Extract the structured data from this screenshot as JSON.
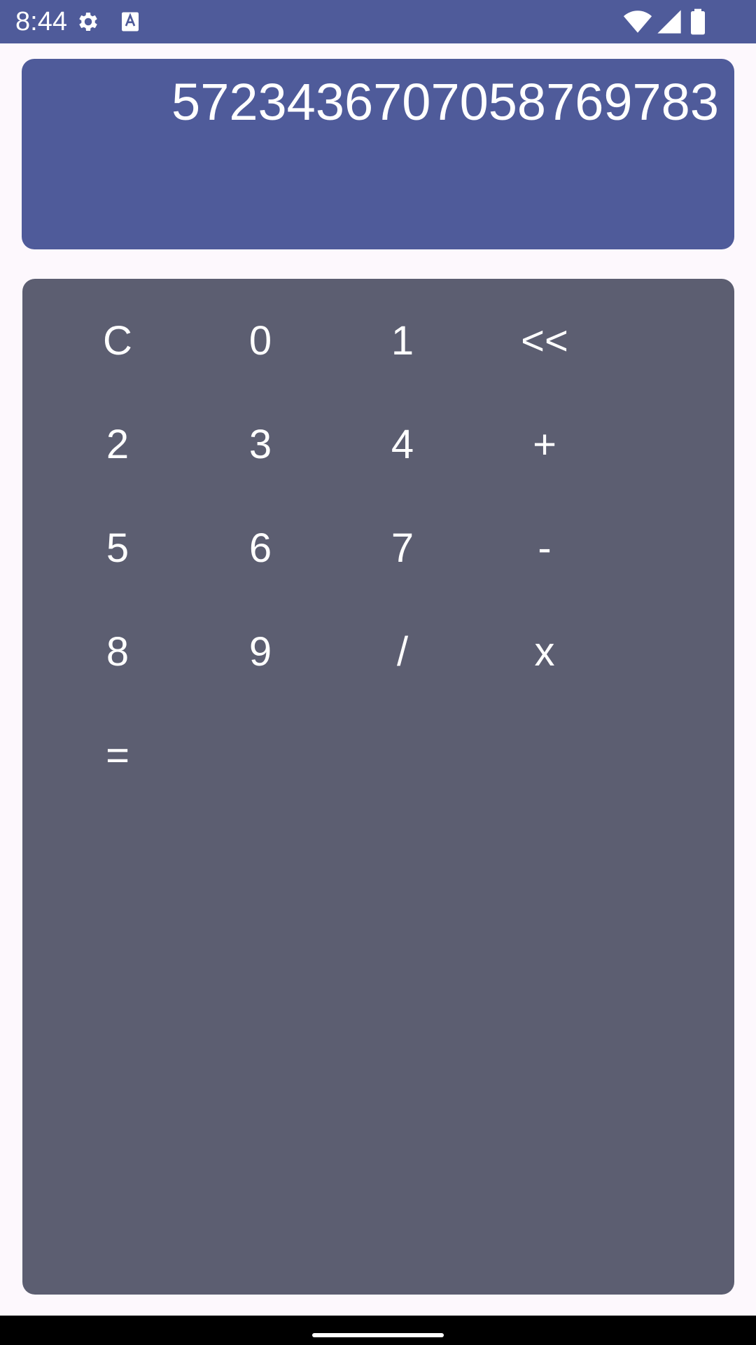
{
  "status_bar": {
    "time": "8:44",
    "icons": [
      "gear-icon",
      "text-a-icon",
      "wifi-icon",
      "signal-icon",
      "battery-icon"
    ],
    "color": "#4f5b9a"
  },
  "display": {
    "value": "572343670705876978 3",
    "color": "#4f5b9a"
  },
  "keypad": {
    "color": "#5c5e71",
    "keys": [
      {
        "label": "C"
      },
      {
        "label": "0"
      },
      {
        "label": "1"
      },
      {
        "label": "<<"
      },
      {
        "label": "2"
      },
      {
        "label": "3"
      },
      {
        "label": "4"
      },
      {
        "label": "+"
      },
      {
        "label": "5"
      },
      {
        "label": "6"
      },
      {
        "label": "7"
      },
      {
        "label": "-"
      },
      {
        "label": "8"
      },
      {
        "label": "9"
      },
      {
        "label": "/"
      },
      {
        "label": "x"
      },
      {
        "label": "="
      }
    ]
  }
}
